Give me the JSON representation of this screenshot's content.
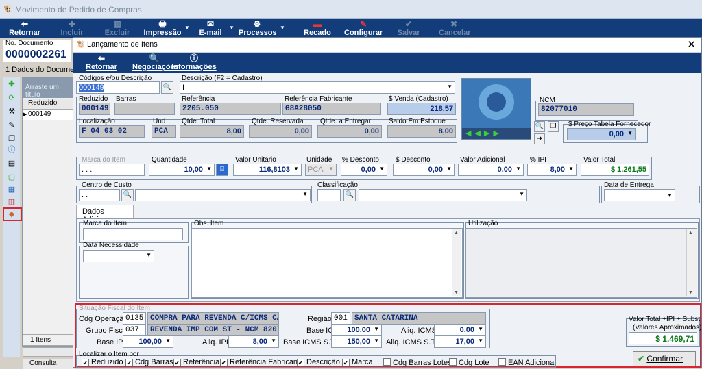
{
  "bg": {
    "title": "Movimento de Pedido de Compras",
    "toolbar": [
      {
        "label": "Retornar",
        "icon": "back-icon"
      },
      {
        "label": "Incluir",
        "icon": "plus-icon"
      },
      {
        "label": "Excluir",
        "icon": "delete-icon"
      },
      {
        "label": "Impressão",
        "icon": "printer-icon"
      },
      {
        "label": "E-mail",
        "icon": "email-icon"
      },
      {
        "label": "Processos",
        "icon": "gear-icon"
      },
      {
        "label": "Recado",
        "icon": "message-icon"
      },
      {
        "label": "Configurar",
        "icon": "wrench-icon"
      },
      {
        "label": "Salvar",
        "icon": "check-icon"
      },
      {
        "label": "Cancelar",
        "icon": "cancel-icon"
      }
    ],
    "doc_label": "No. Documento",
    "doc_number": "0000002261",
    "tab": "1 Dados do Documento",
    "grid_header": "Arraste um título",
    "grid_col": "Reduzido",
    "grid_row": "000149",
    "itens": "1 Itens",
    "consulta": "Consulta"
  },
  "dlg": {
    "title": "Lançamento de Itens",
    "close": "✕",
    "toolbar": [
      {
        "label": "Retornar",
        "icon": "back-icon"
      },
      {
        "label": "Negociações",
        "icon": "search-doc-icon"
      },
      {
        "label": "Informações",
        "icon": "info-icon"
      }
    ],
    "codigos": {
      "label": "Códigos e/ou Descrição",
      "value": "000149"
    },
    "descricao": {
      "label": "Descrição (F2 = Cadastro)",
      "value": "I"
    },
    "reduzido": {
      "label": "Reduzido",
      "value": "000149"
    },
    "barras": {
      "label": "Barras",
      "value": ""
    },
    "referencia": {
      "label": "Referência",
      "value": "2205.050"
    },
    "ref_fabricante": {
      "label": "Referência Fabricante",
      "value": "G8A28050"
    },
    "venda": {
      "label": "$ Venda (Cadastro)",
      "value": "218,57"
    },
    "localizacao": {
      "label": "Localização",
      "value": "F 04 03 02"
    },
    "und": {
      "label": "Und",
      "value": "PCA"
    },
    "qtde_total": {
      "label": "Qtde. Total",
      "value": "8,00"
    },
    "qtde_reservada": {
      "label": "Qtde. Reservada",
      "value": "0,00"
    },
    "qtde_entregar": {
      "label": "Qtde. a Entregar",
      "value": "0,00"
    },
    "saldo": {
      "label": "Saldo Em Estoque",
      "value": "8,00"
    },
    "ncm": {
      "label": "NCM",
      "value": "82077010"
    },
    "preco_fornecedor": {
      "label": "$ Preço Tabela Fornecedor",
      "value": "0,00"
    },
    "marca": {
      "label": "Marca do Item",
      "value": ". . ."
    },
    "quantidade": {
      "label": "Quantidade",
      "value": "10,00"
    },
    "valor_unitario": {
      "label": "Valor Unitário",
      "value": "116,8103"
    },
    "unidade": {
      "label": "Unidade",
      "value": "PCA"
    },
    "pct_desconto": {
      "label": "% Desconto",
      "value": "0,00"
    },
    "desconto": {
      "label": "$ Desconto",
      "value": "0,00"
    },
    "valor_adicional": {
      "label": "Valor Adicional",
      "value": "0,00"
    },
    "pct_ipi": {
      "label": "% IPI",
      "value": "8,00"
    },
    "valor_total": {
      "label": "Valor Total",
      "value": "$ 1.261,55"
    },
    "centro_custo": {
      "label": "Centro de Custo",
      "value": ". ."
    },
    "classificacao": {
      "label": "Classificação",
      "value": ""
    },
    "data_entrega": {
      "label": "Data de Entrega",
      "value": ""
    },
    "tab_dados": "Dados Adicionais",
    "marca2": {
      "label": "Marca do Item"
    },
    "obs": {
      "label": "Obs. Item"
    },
    "utilizacao": {
      "label": "Utilização"
    },
    "data_necessidade": {
      "label": "Data Necessidade"
    },
    "fiscal": {
      "title": "Situação Fiscal do Item",
      "cdg_operacao_label": "Cdg Operação",
      "cdg_operacao": "0135",
      "cdg_operacao_desc": "COMPRA PARA REVENDA C/ICMS CA",
      "grupo_label": "Grupo Fiscal",
      "grupo": "037",
      "grupo_desc": "REVENDA IMP COM ST - NCM 8207 -",
      "regiao_label": "Região",
      "regiao": "001",
      "regiao_desc": "SANTA CATARINA",
      "base_icms_label": "Base ICMS",
      "base_icms": "100,00",
      "aliq_icms_label": "Aliq. ICMS",
      "aliq_icms": "0,00",
      "base_ipi_label": "Base IPI",
      "base_ipi": "100,00",
      "aliq_ipi_label": "Aliq. IPI",
      "aliq_ipi": "8,00",
      "base_icms_st_label": "Base ICMS S.T.",
      "base_icms_st": "150,00",
      "aliq_icms_st_label": "Aliq. ICMS S.T.",
      "aliq_icms_st": "17,00"
    },
    "valor_total_ipi": {
      "label1": "Valor Total +IPI + Subst.",
      "label2": "(Valores Aproximados)",
      "value": "$ 1.469,71"
    },
    "localizar": {
      "label": "Localizar o Item por",
      "options": [
        {
          "label": "Reduzido",
          "checked": true
        },
        {
          "label": "Cdg Barras",
          "checked": true
        },
        {
          "label": "Referência",
          "checked": true
        },
        {
          "label": "Referência Fabricante",
          "checked": true
        },
        {
          "label": "Descrição",
          "checked": true
        },
        {
          "label": "Marca",
          "checked": true
        },
        {
          "label": "Cdg Barras Lotes",
          "checked": false
        },
        {
          "label": "Cdg Lote",
          "checked": false
        },
        {
          "label": "EAN Adicional",
          "checked": false
        }
      ]
    },
    "confirmar": "Confirmar"
  }
}
